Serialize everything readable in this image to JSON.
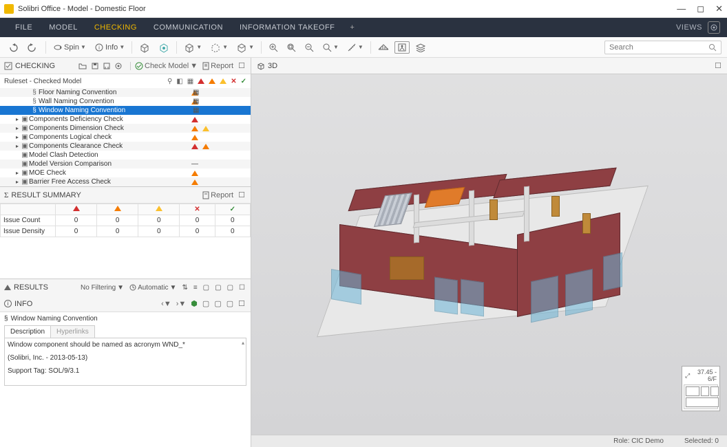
{
  "window": {
    "title": "Solibri Office - Model - Domestic Floor"
  },
  "menu": {
    "items": [
      "FILE",
      "MODEL",
      "CHECKING",
      "COMMUNICATION",
      "INFORMATION TAKEOFF"
    ],
    "active_index": 2,
    "views_label": "VIEWS"
  },
  "toolbar": {
    "spin_label": "Spin",
    "info_label": "Info",
    "search_placeholder": "Search"
  },
  "checking_panel": {
    "title": "CHECKING",
    "check_model_label": "Check Model",
    "report_label": "Report",
    "ruleset_header": "Ruleset - Checked Model",
    "rules": [
      {
        "name": "Floor Naming Convention",
        "indent": 2,
        "icon": "§",
        "severities": [
          "orange"
        ],
        "grid": true
      },
      {
        "name": "Wall Naming Convention",
        "indent": 2,
        "icon": "§",
        "severities": [
          "orange"
        ],
        "grid": true
      },
      {
        "name": "Window Naming Convention",
        "indent": 2,
        "icon": "§",
        "severities": [],
        "selected": true,
        "grid": true
      },
      {
        "name": "Components Deficiency Check",
        "indent": 1,
        "icon": "▣",
        "caret": "▸",
        "severities": [
          "red"
        ]
      },
      {
        "name": "Components Dimension Check",
        "indent": 1,
        "icon": "▣",
        "caret": "▸",
        "severities": [
          "orange",
          "yellow"
        ]
      },
      {
        "name": "Components Logical check",
        "indent": 1,
        "icon": "▣",
        "caret": "▸",
        "severities": [
          "orange"
        ]
      },
      {
        "name": "Components Clearance Check",
        "indent": 1,
        "icon": "▣",
        "caret": "▸",
        "severities": [
          "red",
          "orange"
        ]
      },
      {
        "name": "Model Clash Detection",
        "indent": 1,
        "icon": "▣",
        "severities": []
      },
      {
        "name": "Model Version Comparison",
        "indent": 1,
        "icon": "▣",
        "severities": [
          "dash"
        ]
      },
      {
        "name": "MOE Check",
        "indent": 1,
        "icon": "▣",
        "caret": "▸",
        "severities": [
          "orange"
        ]
      },
      {
        "name": "Barrier Free Access Check",
        "indent": 1,
        "icon": "▣",
        "caret": "▸",
        "severities": [
          "orange"
        ]
      }
    ]
  },
  "summary_panel": {
    "title": "RESULT SUMMARY",
    "report_label": "Report",
    "rows": [
      {
        "label": "Issue Count",
        "vals": [
          "0",
          "0",
          "0",
          "0",
          "0"
        ]
      },
      {
        "label": "Issue Density",
        "vals": [
          "0",
          "0",
          "0",
          "0",
          "0"
        ]
      }
    ]
  },
  "results_panel": {
    "title": "RESULTS",
    "filtering_label": "No Filtering",
    "automatic_label": "Automatic"
  },
  "info_panel": {
    "title": "INFO",
    "rule_name": "Window Naming Convention",
    "tabs": [
      "Description",
      "Hyperlinks"
    ],
    "active_tab": 0,
    "description_line1": "Window component should be named as acronym WND_*",
    "description_line2": "(Solibri, Inc. - 2013-05-13)",
    "description_line3": "Support Tag: SOL/9/3.1"
  },
  "viewport": {
    "title": "3D",
    "minimap_label": "37.45 - 6/F"
  },
  "statusbar": {
    "role": "Role: CIC Demo",
    "selected": "Selected: 0"
  }
}
